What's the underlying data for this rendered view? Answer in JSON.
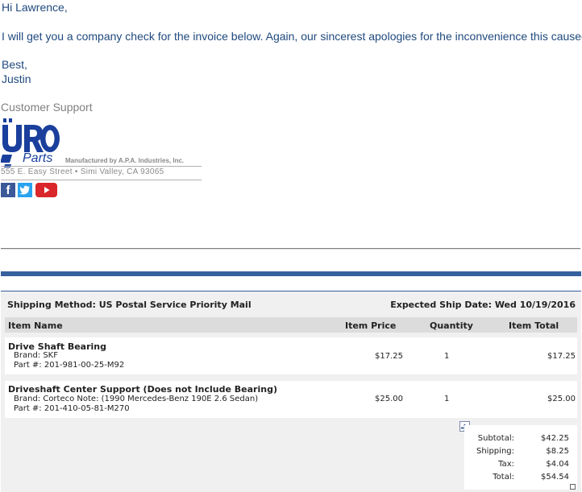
{
  "email": {
    "greeting": "Hi Lawrence,",
    "body": "I will get you a company check for the invoice below.  Again, our sincerest apologies for the inconvenience this caused!",
    "closing": "Best,",
    "name": "Justin"
  },
  "signature": {
    "title": "Customer Support",
    "logo_main": "URO",
    "logo_sub": "Parts",
    "manufacturer": "Manufactured by A.P.A. Industries, Inc.",
    "address": "555 E. Easy Street • Simi Valley, CA 93065",
    "icons": [
      "facebook-icon",
      "twitter-icon",
      "youtube-icon"
    ]
  },
  "order": {
    "shipping_method": "Shipping Method: US Postal Service Priority Mail",
    "expected_ship": "Expected Ship Date: Wed 10/19/2016",
    "columns": [
      "Item Name",
      "Item Price",
      "Quantity",
      "Item Total"
    ],
    "items": [
      {
        "name": "Drive Shaft Bearing",
        "brand": "Brand: SKF",
        "part": "Part #: 201-981-00-25-M92",
        "price": "$17.25",
        "qty": "1",
        "total": "$17.25"
      },
      {
        "name": "Driveshaft Center Support (Does not Include Bearing)",
        "brand": "Brand: Corteco Note: (1990 Mercedes-Benz 190E 2.6 Sedan)",
        "part": "Part #: 201-410-05-81-M270",
        "price": "$25.00",
        "qty": "1",
        "total": "$25.00"
      }
    ],
    "totals": {
      "subtotal_label": "Subtotal:",
      "subtotal": "$42.25",
      "shipping_label": "Shipping:",
      "shipping": "$8.25",
      "tax_label": "Tax:",
      "tax": "$4.04",
      "total_label": "Total:",
      "total": "$54.54"
    }
  },
  "colors": {
    "email_text": "#1f497d",
    "brand_blue": "#1a3f9c",
    "bar_blue": "#365f9e"
  }
}
